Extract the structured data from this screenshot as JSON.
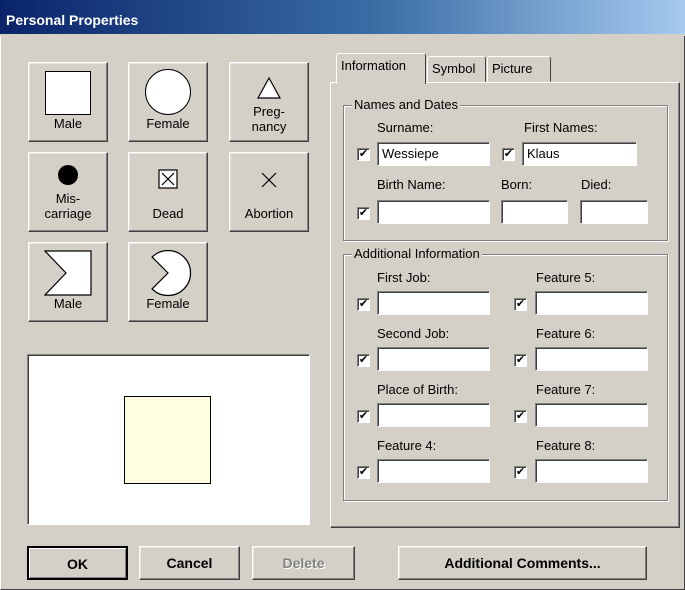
{
  "window": {
    "title": "Personal Properties"
  },
  "symbols": [
    {
      "name": "male-square",
      "label": "Male",
      "icon": "square-icon"
    },
    {
      "name": "female-circle",
      "label": "Female",
      "icon": "circle-icon"
    },
    {
      "name": "pregnancy",
      "label_line1": "Preg-",
      "label_line2": "nancy",
      "icon": "triangle-icon"
    },
    {
      "name": "miscarriage",
      "label_line1": "Mis-",
      "label_line2": "carriage",
      "icon": "filled-dot-icon"
    },
    {
      "name": "dead",
      "label": "Dead",
      "icon": "crossed-box-icon"
    },
    {
      "name": "abortion",
      "label": "Abortion",
      "icon": "x-mark-icon"
    },
    {
      "name": "male-notched",
      "label": "Male",
      "icon": "notched-square-icon"
    },
    {
      "name": "female-pacman",
      "label": "Female",
      "icon": "notched-circle-icon"
    }
  ],
  "tabs": [
    {
      "label": "Information",
      "active": true
    },
    {
      "label": "Symbol",
      "active": false
    },
    {
      "label": "Picture",
      "active": false
    }
  ],
  "names_dates": {
    "title": "Names and Dates",
    "surname_label": "Surname:",
    "surname_value": "Wessiepe",
    "surname_checked": true,
    "first_names_label": "First Names:",
    "first_names_value": "Klaus",
    "first_names_checked": true,
    "birth_name_label": "Birth Name:",
    "birth_name_value": "",
    "birth_name_checked": true,
    "born_label": "Born:",
    "born_value": "",
    "died_label": "Died:",
    "died_value": ""
  },
  "additional": {
    "title": "Additional Information",
    "left": [
      {
        "label": "First Job:",
        "value": "",
        "checked": true
      },
      {
        "label": "Second Job:",
        "value": "",
        "checked": true
      },
      {
        "label": "Place of Birth:",
        "value": "",
        "checked": true
      },
      {
        "label": "Feature 4:",
        "value": "",
        "checked": true
      }
    ],
    "right": [
      {
        "label": "Feature 5:",
        "value": "",
        "checked": true
      },
      {
        "label": "Feature 6:",
        "value": "",
        "checked": true
      },
      {
        "label": "Feature 7:",
        "value": "",
        "checked": true
      },
      {
        "label": "Feature 8:",
        "value": "",
        "checked": true
      }
    ]
  },
  "buttons": {
    "ok": "OK",
    "cancel": "Cancel",
    "delete": "Delete",
    "delete_enabled": false,
    "comments": "Additional Comments..."
  },
  "checkmark": "✔",
  "colors": {
    "title_gradient_start": "#0a246a",
    "title_gradient_end": "#a6caf0",
    "face": "#d4d0c8",
    "preview_fill": "#ffffe0"
  }
}
